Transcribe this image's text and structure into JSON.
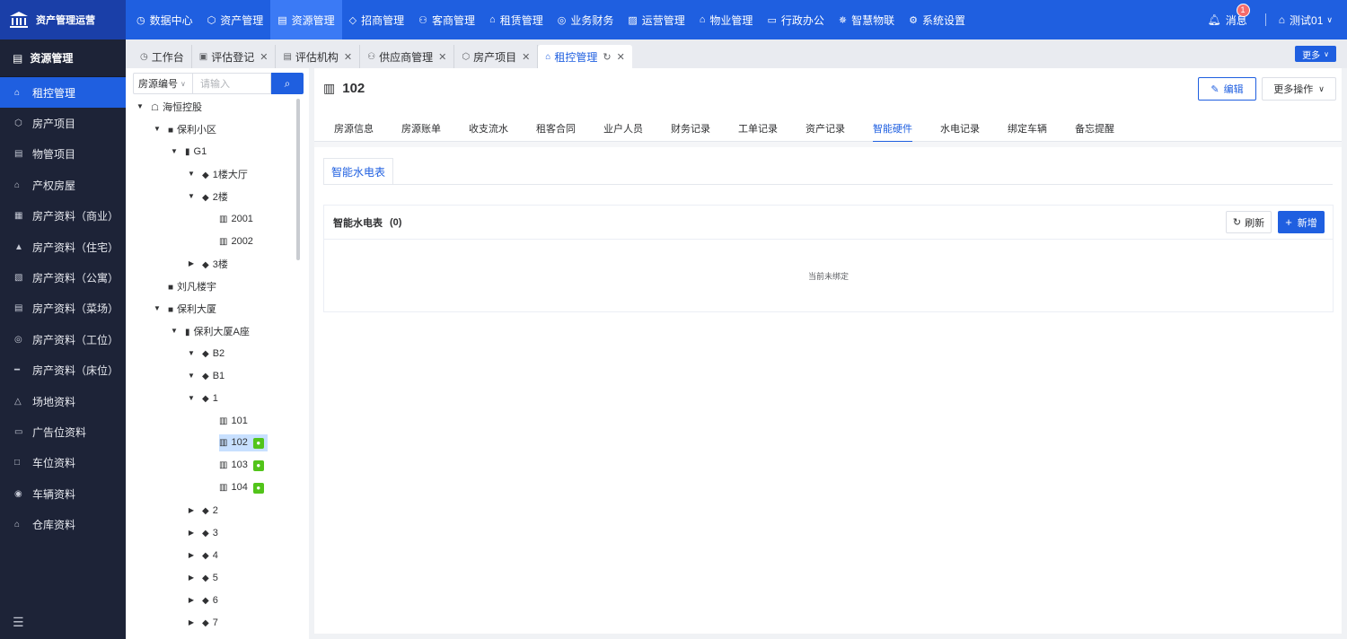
{
  "app": {
    "title": "资产管理运营"
  },
  "nav": [
    {
      "label": "数据中心",
      "icon": "dashboard-icon"
    },
    {
      "label": "资产管理",
      "icon": "cube-icon"
    },
    {
      "label": "资源管理",
      "icon": "document-icon",
      "active": true
    },
    {
      "label": "招商管理",
      "icon": "tag-icon"
    },
    {
      "label": "客商管理",
      "icon": "people-icon"
    },
    {
      "label": "租赁管理",
      "icon": "home-icon"
    },
    {
      "label": "业务财务",
      "icon": "money-icon"
    },
    {
      "label": "运营管理",
      "icon": "chart-icon"
    },
    {
      "label": "物业管理",
      "icon": "house-icon"
    },
    {
      "label": "行政办公",
      "icon": "monitor-icon"
    },
    {
      "label": "智慧物联",
      "icon": "iot-icon"
    },
    {
      "label": "系统设置",
      "icon": "gear-icon"
    }
  ],
  "topright": {
    "messages": "消息",
    "badge": "1",
    "user": "测试01"
  },
  "sidebar": {
    "header": "资源管理",
    "items": [
      {
        "label": "租控管理",
        "active": true
      },
      {
        "label": "房产项目"
      },
      {
        "label": "物管项目"
      },
      {
        "label": "产权房屋"
      },
      {
        "label": "房产资料（商业）"
      },
      {
        "label": "房产资料（住宅）"
      },
      {
        "label": "房产资料（公寓）"
      },
      {
        "label": "房产资料（菜场）"
      },
      {
        "label": "房产资料（工位）"
      },
      {
        "label": "房产资料（床位）"
      },
      {
        "label": "场地资料"
      },
      {
        "label": "广告位资料"
      },
      {
        "label": "车位资料"
      },
      {
        "label": "车辆资料"
      },
      {
        "label": "仓库资料"
      }
    ]
  },
  "tabs": [
    {
      "label": "工作台"
    },
    {
      "label": "评估登记"
    },
    {
      "label": "评估机构"
    },
    {
      "label": "供应商管理"
    },
    {
      "label": "房产项目"
    },
    {
      "label": "租控管理",
      "active": true
    }
  ],
  "tabs_more": "更多",
  "search": {
    "select": "房源编号",
    "placeholder": "请输入"
  },
  "tree": [
    {
      "label": "海恒控股",
      "level": 0,
      "arrow": "down",
      "icon": "org"
    },
    {
      "label": "保利小区",
      "level": 1,
      "arrow": "down",
      "icon": "building"
    },
    {
      "label": "G1",
      "level": 2,
      "arrow": "down",
      "icon": "tower"
    },
    {
      "label": "1楼大厅",
      "level": 3,
      "arrow": "down",
      "icon": "layers"
    },
    {
      "label": "2楼",
      "level": 3,
      "arrow": "down",
      "icon": "layers"
    },
    {
      "label": "2001",
      "level": 4,
      "arrow": "",
      "icon": "room"
    },
    {
      "label": "2002",
      "level": 4,
      "arrow": "",
      "icon": "room"
    },
    {
      "label": "3楼",
      "level": 3,
      "arrow": "right",
      "icon": "layers"
    },
    {
      "label": "刘凡楼宇",
      "level": 1,
      "arrow": "",
      "icon": "building"
    },
    {
      "label": "保利大厦",
      "level": 1,
      "arrow": "down",
      "icon": "building"
    },
    {
      "label": "保利大厦A座",
      "level": 2,
      "arrow": "down",
      "icon": "tower"
    },
    {
      "label": "B2",
      "level": 3,
      "arrow": "down",
      "icon": "layers"
    },
    {
      "label": "B1",
      "level": 3,
      "arrow": "down",
      "icon": "layers"
    },
    {
      "label": "1",
      "level": 3,
      "arrow": "down",
      "icon": "layers"
    },
    {
      "label": "101",
      "level": 4,
      "arrow": "",
      "icon": "room"
    },
    {
      "label": "102",
      "level": 4,
      "arrow": "",
      "icon": "room",
      "selected": true,
      "tenant": true
    },
    {
      "label": "103",
      "level": 4,
      "arrow": "",
      "icon": "room",
      "tenant": true
    },
    {
      "label": "104",
      "level": 4,
      "arrow": "",
      "icon": "room",
      "tenant": true
    },
    {
      "label": "2",
      "level": 3,
      "arrow": "right",
      "icon": "layers"
    },
    {
      "label": "3",
      "level": 3,
      "arrow": "right",
      "icon": "layers"
    },
    {
      "label": "4",
      "level": 3,
      "arrow": "right",
      "icon": "layers"
    },
    {
      "label": "5",
      "level": 3,
      "arrow": "right",
      "icon": "layers"
    },
    {
      "label": "6",
      "level": 3,
      "arrow": "right",
      "icon": "layers"
    },
    {
      "label": "7",
      "level": 3,
      "arrow": "right",
      "icon": "layers"
    }
  ],
  "main": {
    "title": "102",
    "edit": "编辑",
    "more_ops": "更多操作",
    "subtabs": [
      {
        "label": "房源信息"
      },
      {
        "label": "房源账单"
      },
      {
        "label": "收支流水"
      },
      {
        "label": "租客合同"
      },
      {
        "label": "业户人员"
      },
      {
        "label": "财务记录"
      },
      {
        "label": "工单记录"
      },
      {
        "label": "资产记录"
      },
      {
        "label": "智能硬件",
        "active": true
      },
      {
        "label": "水电记录"
      },
      {
        "label": "绑定车辆"
      },
      {
        "label": "备忘提醒"
      }
    ],
    "inner_tab": "智能水电表",
    "card": {
      "title": "智能水电表",
      "count": "(0)",
      "refresh": "刷新",
      "add": "新增",
      "empty": "当前未绑定"
    }
  }
}
